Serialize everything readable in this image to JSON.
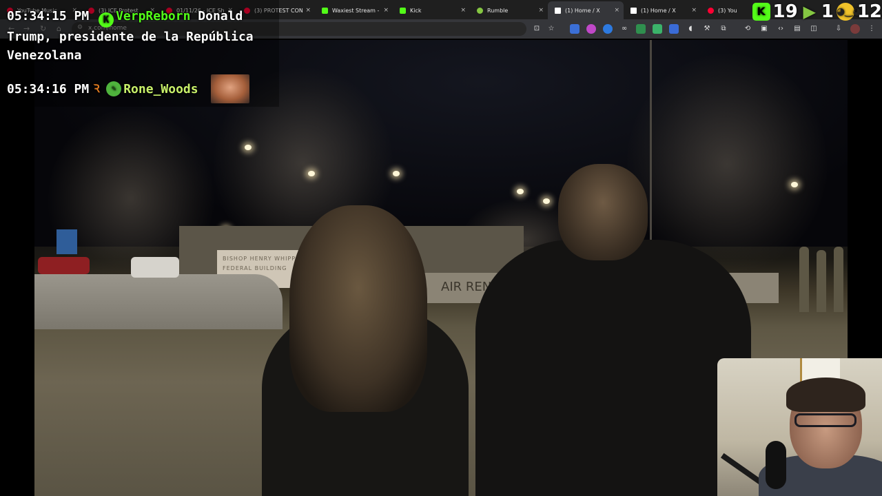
{
  "browser": {
    "tabs": [
      {
        "label": "YouTube Music",
        "favicon_color": "#ff0033"
      },
      {
        "label": "(3) ICE Protest",
        "favicon_color": "#ff0033"
      },
      {
        "label": "01/11/26 - ICE Sh",
        "favicon_color": "#ff0033"
      },
      {
        "label": "(3) PROTEST CON",
        "favicon_color": "#ff0033"
      },
      {
        "label": "Waxiest Stream - ",
        "favicon_color": "#53fc18"
      },
      {
        "label": "Kick",
        "favicon_color": "#53fc18"
      },
      {
        "label": "Rumble",
        "favicon_color": "#85c742"
      },
      {
        "label": "(1) Home / X",
        "favicon_color": "#ffffff",
        "active": true
      },
      {
        "label": "(1) Home / X",
        "favicon_color": "#ffffff"
      },
      {
        "label": "(3) You",
        "favicon_color": "#ff0033"
      }
    ],
    "close_glyph": "×",
    "url": "x.com/home",
    "nav_icons": [
      "back-icon",
      "forward-icon",
      "reload-icon",
      "home-icon"
    ]
  },
  "chat": {
    "messages": [
      {
        "time": "05:34:15 PM",
        "badge_icon": "kick-badge-icon",
        "badge_glyph": "K",
        "username": "VerpReborn",
        "text": "Donald Trump, presidente de la República Venezolana"
      },
      {
        "time": "05:34:16 PM",
        "badge_icon": "rank-badge-icon",
        "badge_glyph": "Ꝛ",
        "badge2_glyph": "✎",
        "username": "Rone_Woods"
      }
    ]
  },
  "counters": {
    "kick_count": "19",
    "rumble_count": "1",
    "mask_count": "12",
    "kick_glyph": "K",
    "rumble_glyph": "▶",
    "mask_glyph": "◕‿◕"
  },
  "video": {
    "sign_text": "BISHOP HENRY WHIPPLE FEDERAL BUILDING",
    "barrier_text": "AIR RENEE"
  },
  "colors": {
    "kick_green": "#53fc18",
    "chat_text": "#ffffff"
  }
}
